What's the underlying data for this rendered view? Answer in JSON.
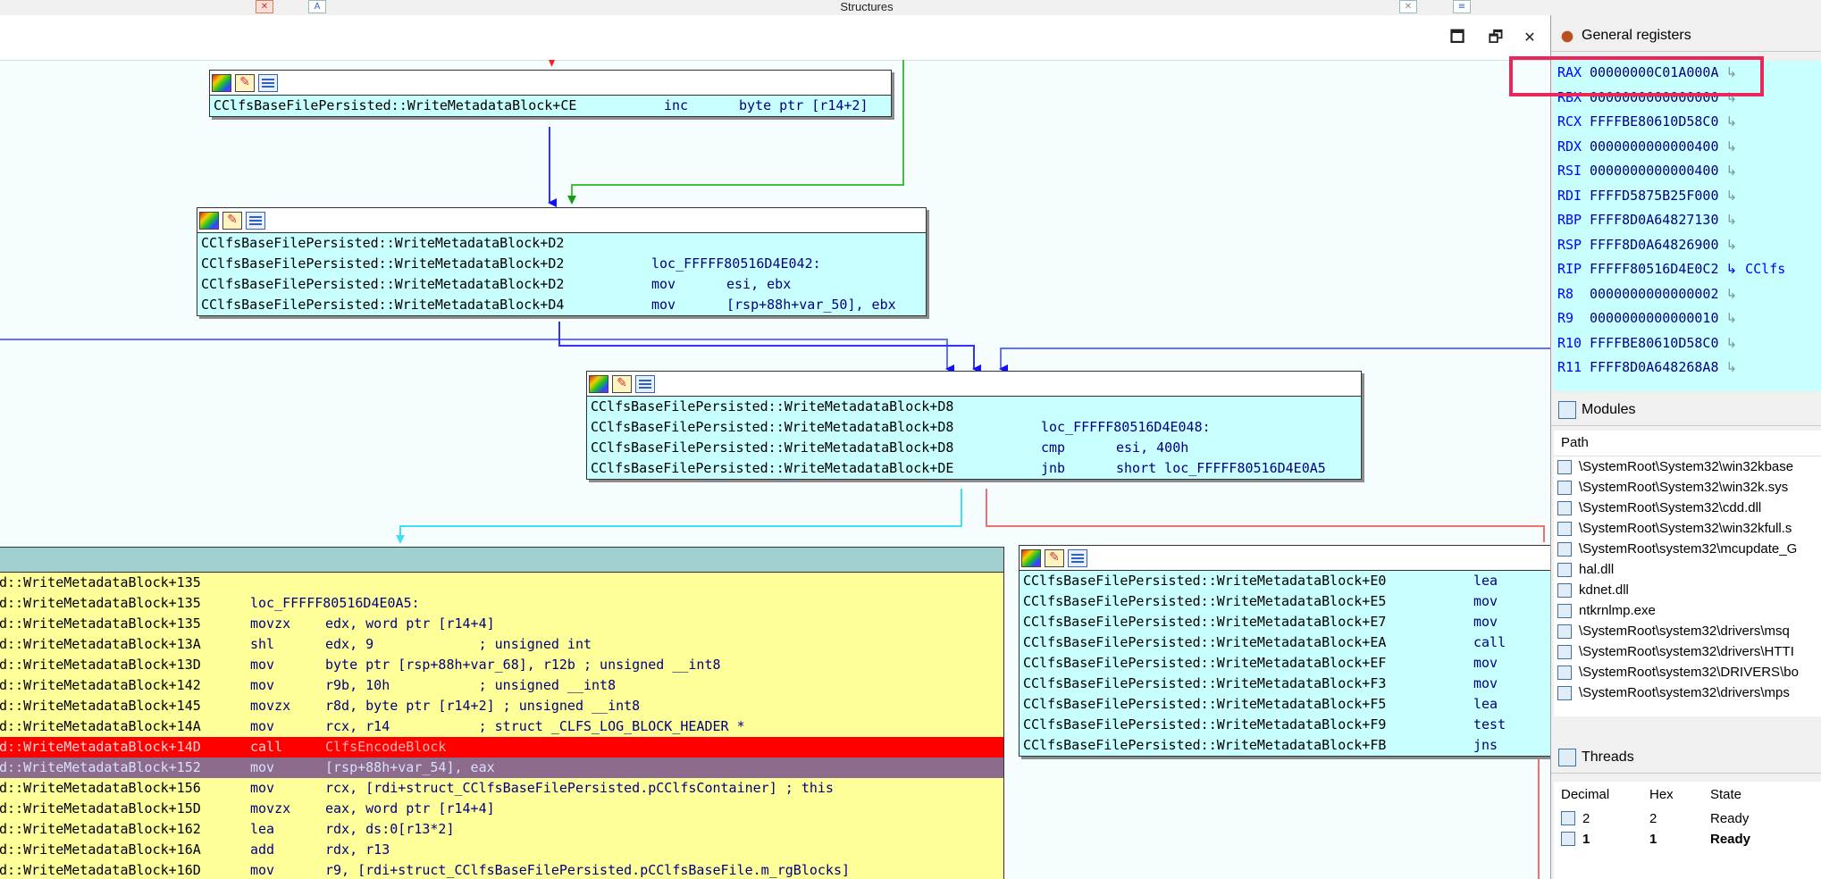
{
  "topbar": {
    "title": "Structures"
  },
  "window_controls": {
    "restore": "🗖",
    "float": "🗗",
    "close": "✕"
  },
  "blocks": [
    {
      "rows": [
        {
          "a": "CClfsBaseFilePersisted::WriteMetadataBlock+CE",
          "b": "inc",
          "c": "byte ptr [r14+2]"
        }
      ]
    },
    {
      "rows": [
        {
          "a": "CClfsBaseFilePersisted::WriteMetadataBlock+D2",
          "b": "",
          "c": ""
        },
        {
          "a": "CClfsBaseFilePersisted::WriteMetadataBlock+D2",
          "b": "loc_FFFFF80516D4E042:",
          "c": ""
        },
        {
          "a": "CClfsBaseFilePersisted::WriteMetadataBlock+D2",
          "b": "mov",
          "c": "esi, ebx"
        },
        {
          "a": "CClfsBaseFilePersisted::WriteMetadataBlock+D4",
          "b": "mov",
          "c": "[rsp+88h+var_50], ebx"
        }
      ]
    },
    {
      "rows": [
        {
          "a": "CClfsBaseFilePersisted::WriteMetadataBlock+D8",
          "b": "",
          "c": ""
        },
        {
          "a": "CClfsBaseFilePersisted::WriteMetadataBlock+D8",
          "b": "loc_FFFFF80516D4E048:",
          "c": ""
        },
        {
          "a": "CClfsBaseFilePersisted::WriteMetadataBlock+D8",
          "b": "cmp",
          "c": "esi, 400h"
        },
        {
          "a": "CClfsBaseFilePersisted::WriteMetadataBlock+DE",
          "b": "jnb",
          "c": "short loc_FFFFF80516D4E0A5"
        }
      ]
    },
    {
      "rows": [
        {
          "a": "d::WriteMetadataBlock+135",
          "b": "",
          "c": ""
        },
        {
          "a": "d::WriteMetadataBlock+135",
          "b": "loc_FFFFF80516D4E0A5:",
          "c": ""
        },
        {
          "a": "d::WriteMetadataBlock+135",
          "b": "movzx",
          "c": "edx, word ptr [r14+4]"
        },
        {
          "a": "d::WriteMetadataBlock+13A",
          "b": "shl",
          "c": "edx, 9             ; unsigned int"
        },
        {
          "a": "d::WriteMetadataBlock+13D",
          "b": "mov",
          "c": "byte ptr [rsp+88h+var_68], r12b ; unsigned __int8"
        },
        {
          "a": "d::WriteMetadataBlock+142",
          "b": "mov",
          "c": "r9b, 10h           ; unsigned __int8"
        },
        {
          "a": "d::WriteMetadataBlock+145",
          "b": "movzx",
          "c": "r8d, byte ptr [r14+2] ; unsigned __int8"
        },
        {
          "a": "d::WriteMetadataBlock+14A",
          "b": "mov",
          "c": "rcx, r14           ; struct _CLFS_LOG_BLOCK_HEADER *"
        },
        {
          "a": "d::WriteMetadataBlock+14D",
          "b": "call",
          "c": "ClfsEncodeBlock"
        },
        {
          "a": "d::WriteMetadataBlock+152",
          "b": "mov",
          "c": "[rsp+88h+var_54], eax"
        },
        {
          "a": "d::WriteMetadataBlock+156",
          "b": "mov",
          "c": "rcx, [rdi+struct_CClfsBaseFilePersisted.pCClfsContainer] ; this"
        },
        {
          "a": "d::WriteMetadataBlock+15D",
          "b": "movzx",
          "c": "eax, word ptr [r14+4]"
        },
        {
          "a": "d::WriteMetadataBlock+162",
          "b": "lea",
          "c": "rdx, ds:0[r13*2]"
        },
        {
          "a": "d::WriteMetadataBlock+16A",
          "b": "add",
          "c": "rdx, r13"
        },
        {
          "a": "d::WriteMetadataBlock+16D",
          "b": "mov",
          "c": "r9, [rdi+struct_CClfsBaseFilePersisted.pCClfsBaseFile.m_rgBlocks]"
        }
      ]
    },
    {
      "rows": [
        {
          "a": "CClfsBaseFilePersisted::WriteMetadataBlock+E0",
          "b": "lea",
          "c": ""
        },
        {
          "a": "CClfsBaseFilePersisted::WriteMetadataBlock+E5",
          "b": "mov",
          "c": ""
        },
        {
          "a": "CClfsBaseFilePersisted::WriteMetadataBlock+E7",
          "b": "mov",
          "c": ""
        },
        {
          "a": "CClfsBaseFilePersisted::WriteMetadataBlock+EA",
          "b": "call",
          "c": ""
        },
        {
          "a": "CClfsBaseFilePersisted::WriteMetadataBlock+EF",
          "b": "mov",
          "c": ""
        },
        {
          "a": "CClfsBaseFilePersisted::WriteMetadataBlock+F3",
          "b": "mov",
          "c": ""
        },
        {
          "a": "CClfsBaseFilePersisted::WriteMetadataBlock+F5",
          "b": "lea",
          "c": ""
        },
        {
          "a": "CClfsBaseFilePersisted::WriteMetadataBlock+F9",
          "b": "test",
          "c": ""
        },
        {
          "a": "CClfsBaseFilePersisted::WriteMetadataBlock+FB",
          "b": "jns",
          "c": ""
        }
      ]
    }
  ],
  "registers": {
    "title": "General registers",
    "items": [
      {
        "name": "RAX",
        "value": "00000000C01A000A",
        "extra": ""
      },
      {
        "name": "RBX",
        "value": "0000000000000000",
        "extra": ""
      },
      {
        "name": "RCX",
        "value": "FFFFBE80610D58C0",
        "extra": ""
      },
      {
        "name": "RDX",
        "value": "0000000000000400",
        "extra": ""
      },
      {
        "name": "RSI",
        "value": "0000000000000400",
        "extra": ""
      },
      {
        "name": "RDI",
        "value": "FFFFD5875B25F000",
        "extra": ""
      },
      {
        "name": "RBP",
        "value": "FFFF8D0A64827130",
        "extra": ""
      },
      {
        "name": "RSP",
        "value": "FFFF8D0A64826900",
        "extra": ""
      },
      {
        "name": "RIP",
        "value": "FFFFF80516D4E0C2",
        "extra": "CClfs"
      },
      {
        "name": "R8",
        "value": "0000000000000002",
        "extra": ""
      },
      {
        "name": "R9",
        "value": "0000000000000010",
        "extra": ""
      },
      {
        "name": "R10",
        "value": "FFFFBE80610D58C0",
        "extra": ""
      },
      {
        "name": "R11",
        "value": "FFFF8D0A648268A8",
        "extra": ""
      }
    ]
  },
  "modules": {
    "title": "Modules",
    "column": "Path",
    "items": [
      "\\SystemRoot\\System32\\win32kbase",
      "\\SystemRoot\\System32\\win32k.sys",
      "\\SystemRoot\\System32\\cdd.dll",
      "\\SystemRoot\\System32\\win32kfull.s",
      "\\SystemRoot\\system32\\mcupdate_G",
      "hal.dll",
      "kdnet.dll",
      "ntkrnlmp.exe",
      "\\SystemRoot\\system32\\drivers\\msq",
      "\\SystemRoot\\system32\\drivers\\HTTI",
      "\\SystemRoot\\system32\\DRIVERS\\bo",
      "\\SystemRoot\\system32\\drivers\\mps"
    ]
  },
  "threads": {
    "title": "Threads",
    "columns": [
      "Decimal",
      "Hex",
      "State"
    ],
    "items": [
      {
        "dec": "2",
        "hex": "2",
        "state": "Ready"
      },
      {
        "dec": "1",
        "hex": "1",
        "state": "Ready"
      }
    ]
  }
}
